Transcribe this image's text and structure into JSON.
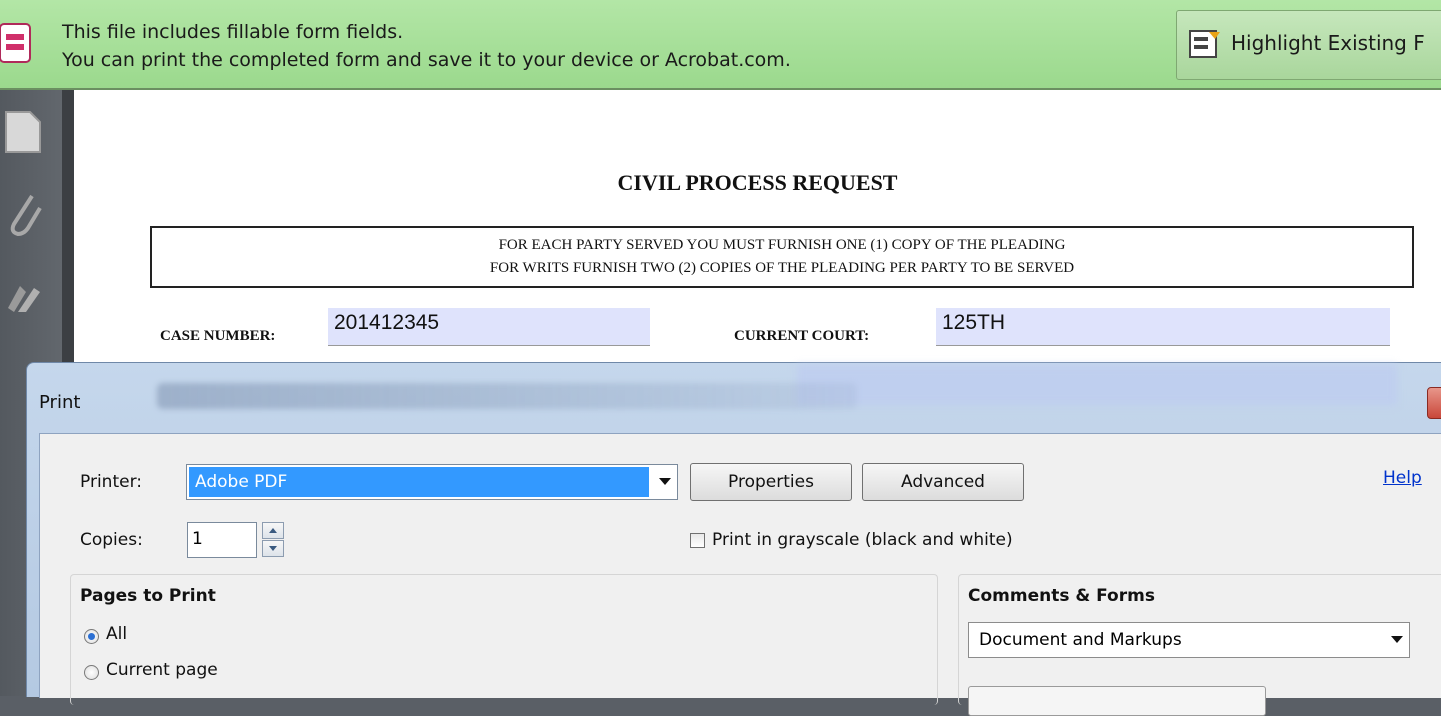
{
  "notification": {
    "line1": "This file includes fillable form fields.",
    "line2": "You can print the completed form and save it to your device or Acrobat.com.",
    "highlight_button": "Highlight Existing F"
  },
  "document": {
    "title": "CIVIL PROCESS REQUEST",
    "notice_line1": "FOR EACH PARTY SERVED YOU MUST FURNISH ONE (1) COPY OF THE PLEADING",
    "notice_line2": "FOR WRITS FURNISH TWO (2) COPIES OF THE PLEADING PER PARTY TO BE SERVED",
    "case_number_label": "CASE NUMBER:",
    "case_number_value": "201412345",
    "current_court_label": "CURRENT COURT:",
    "current_court_value": "125TH"
  },
  "print_dialog": {
    "title": "Print",
    "printer_label": "Printer:",
    "printer_value": "Adobe PDF",
    "properties_button": "Properties",
    "advanced_button": "Advanced",
    "help_link": "Help",
    "copies_label": "Copies:",
    "copies_value": "1",
    "grayscale_label": "Print in grayscale (black and white)",
    "grayscale_checked": false,
    "pages_to_print": {
      "title": "Pages to Print",
      "options": [
        "All",
        "Current page"
      ],
      "selected": "All"
    },
    "comments_forms": {
      "title": "Comments & Forms",
      "value": "Document and Markups"
    }
  }
}
